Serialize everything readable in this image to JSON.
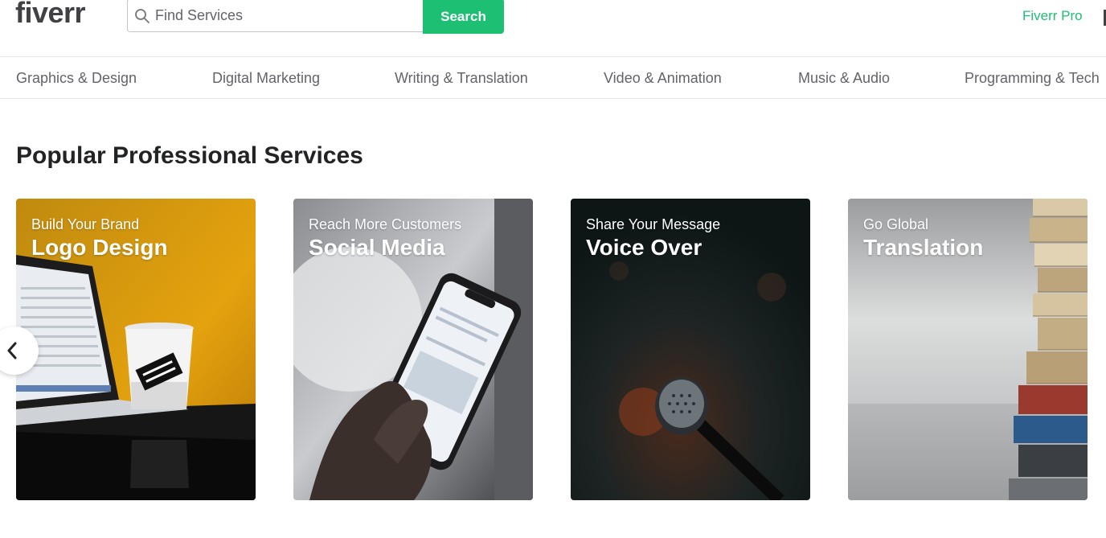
{
  "header": {
    "logo": "fiverr",
    "search": {
      "placeholder": "Find Services",
      "value": ""
    },
    "search_button": "Search",
    "pro_link": "Fiverr Pro"
  },
  "categories": [
    "Graphics & Design",
    "Digital Marketing",
    "Writing & Translation",
    "Video & Animation",
    "Music & Audio",
    "Programming & Tech"
  ],
  "section": {
    "title": "Popular Professional Services"
  },
  "cards": [
    {
      "subtitle": "Build Your Brand",
      "title": "Logo Design"
    },
    {
      "subtitle": "Reach More Customers",
      "title": "Social Media"
    },
    {
      "subtitle": "Share Your Message",
      "title": "Voice Over"
    },
    {
      "subtitle": "Go Global",
      "title": "Translation"
    }
  ],
  "icons": {
    "search": "search-icon",
    "prev": "chevron-left-icon"
  },
  "colors": {
    "brand_green": "#1dbf73",
    "logo_text": "#404145",
    "nav_text": "#62646a",
    "heading": "#222325"
  }
}
